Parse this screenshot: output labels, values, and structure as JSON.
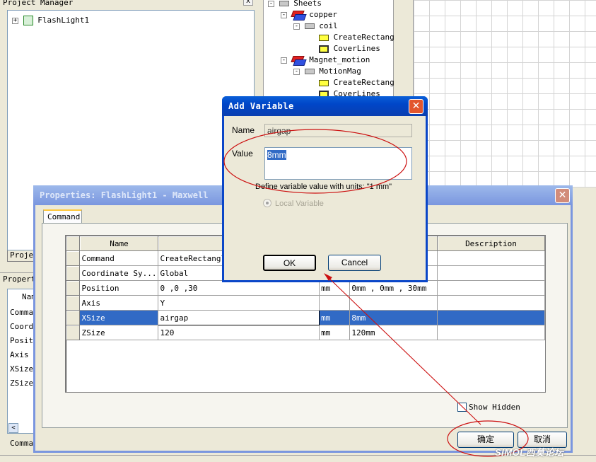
{
  "project_manager": {
    "title": "Project Manager",
    "tree": [
      {
        "label": "FlashLight1",
        "expander": "+"
      }
    ],
    "tab_label": "Proje"
  },
  "modeler_tree": {
    "items": [
      {
        "label": "Sheets",
        "icon": "sheet-icon",
        "expander": "-"
      },
      {
        "label": "copper",
        "icon": "solid-object-icon",
        "expander": "-"
      },
      {
        "label": "coil",
        "icon": "sheet-icon",
        "expander": "-"
      },
      {
        "label": "CreateRectang",
        "icon": "rectangle-icon"
      },
      {
        "label": "CoverLines",
        "icon": "cover-lines-icon"
      },
      {
        "label": "Magnet_motion",
        "icon": "solid-object-icon",
        "expander": "-"
      },
      {
        "label": "MotionMag",
        "icon": "sheet-icon",
        "expander": "-"
      },
      {
        "label": "CreateRectang",
        "icon": "rectangle-icon"
      },
      {
        "label": "CoverLines",
        "icon": "cover-lines-icon"
      }
    ]
  },
  "properties_panel": {
    "title": "Properties",
    "column_header": "Nam",
    "rows": [
      "Comman",
      "Coordi",
      "Positi",
      "Axis",
      "XSize",
      "ZSize"
    ],
    "bottom_tab": "Comman"
  },
  "properties_dialog": {
    "title": "Properties: FlashLight1 - Maxwell",
    "tab": "Command",
    "columns": [
      "Name",
      "",
      "",
      "",
      "Description"
    ],
    "rows": [
      {
        "name": "Command",
        "value": "CreateRectangle",
        "unit": "",
        "evaluated": "",
        "description": ""
      },
      {
        "name": "Coordinate Sy...",
        "value": "Global",
        "unit": "",
        "evaluated": "",
        "description": ""
      },
      {
        "name": "Position",
        "value": "0 ,0 ,30",
        "unit": "mm",
        "evaluated": "0mm , 0mm , 30mm",
        "description": ""
      },
      {
        "name": "Axis",
        "value": "Y",
        "unit": "",
        "evaluated": "",
        "description": ""
      },
      {
        "name": "XSize",
        "value": "airgap",
        "unit": "mm",
        "evaluated": "8mm",
        "description": ""
      },
      {
        "name": "ZSize",
        "value": "120",
        "unit": "mm",
        "evaluated": "120mm",
        "description": ""
      }
    ],
    "selected_row": 4,
    "show_hidden_label": "Show Hidden",
    "ok_label": "确定",
    "cancel_label": "取消"
  },
  "add_variable_dialog": {
    "title": "Add Variable",
    "name_label": "Name",
    "name_value": "airgap",
    "value_label": "Value",
    "value_value": "8mm",
    "hint": "Define variable value with units: \"1 mm\"",
    "local_variable_label": "Local Variable",
    "ok_label": "OK",
    "cancel_label": "Cancel"
  },
  "watermark": "SIMOL西莫论坛",
  "colors": {
    "title_bar": "#0a50d0",
    "inactive_title": "#7a96df",
    "selection": "#316ac5",
    "annotation": "#cc0000"
  }
}
